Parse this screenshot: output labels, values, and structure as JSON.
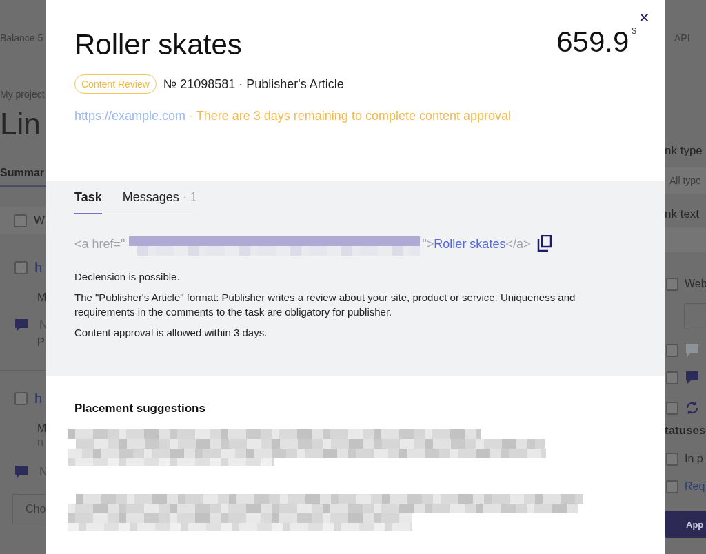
{
  "background_page": {
    "left": [
      {
        "kind": "small",
        "text": "Balance 5"
      },
      {
        "kind": "crumb",
        "text": "My project"
      },
      {
        "kind": "heading",
        "text": "Lin"
      },
      {
        "kind": "tab",
        "text": "Summar"
      },
      {
        "kind": "header-row",
        "text": "W",
        "checked": false
      },
      {
        "kind": "check-link",
        "text": "h",
        "checked": false
      },
      {
        "kind": "line",
        "text": "M"
      },
      {
        "kind": "chat-row",
        "text": "N"
      },
      {
        "kind": "line",
        "text": "P"
      },
      {
        "kind": "rule"
      },
      {
        "kind": "check-link",
        "text": "h",
        "checked": false
      },
      {
        "kind": "line",
        "text": "M"
      },
      {
        "kind": "subline",
        "text": "n"
      },
      {
        "kind": "chat-row",
        "text": "N"
      },
      {
        "kind": "select",
        "text": "Cho"
      }
    ],
    "right": [
      {
        "kind": "small",
        "text": "API"
      },
      {
        "kind": "label",
        "text": "nk type"
      },
      {
        "kind": "select",
        "text": "All type"
      },
      {
        "kind": "label",
        "text": "nk text"
      },
      {
        "kind": "field"
      },
      {
        "kind": "check-text",
        "text": "Web",
        "checked": false
      },
      {
        "kind": "box"
      },
      {
        "kind": "check-chat-light",
        "checked": false
      },
      {
        "kind": "check-chat",
        "checked": false
      },
      {
        "kind": "check-refresh",
        "checked": false
      },
      {
        "kind": "label",
        "text": "tatuses"
      },
      {
        "kind": "check-text",
        "text": "In p",
        "checked": false
      },
      {
        "kind": "check-link",
        "text": "Req",
        "checked": false
      },
      {
        "kind": "button",
        "text": "App"
      }
    ]
  },
  "modal": {
    "close": "×",
    "title": "Roller skates",
    "price": "659.9",
    "currency": "$",
    "status_badge": "Content Review",
    "order_line": "№ 21098581 · Publisher's Article",
    "url": "https://example.com",
    "deadline_note": "- There are 3 days remaining to complete content approval",
    "tabs": [
      {
        "label": "Task",
        "selected": true
      },
      {
        "label": "Messages",
        "count": "· 1",
        "selected": false
      }
    ],
    "link_code": {
      "open": "<a href=\"",
      "close_quote": "\">",
      "anchor": "Roller skates",
      "end": "</a>"
    },
    "description": [
      "Declension is possible.",
      "The \"Publisher's Article\" format: Publisher writes a review about your site, product or service. Uniqueness and requirements in the comments to the task are obligatory for publisher.",
      "Content approval is allowed within 3 days."
    ],
    "placement_title": "Placement suggestions"
  }
}
